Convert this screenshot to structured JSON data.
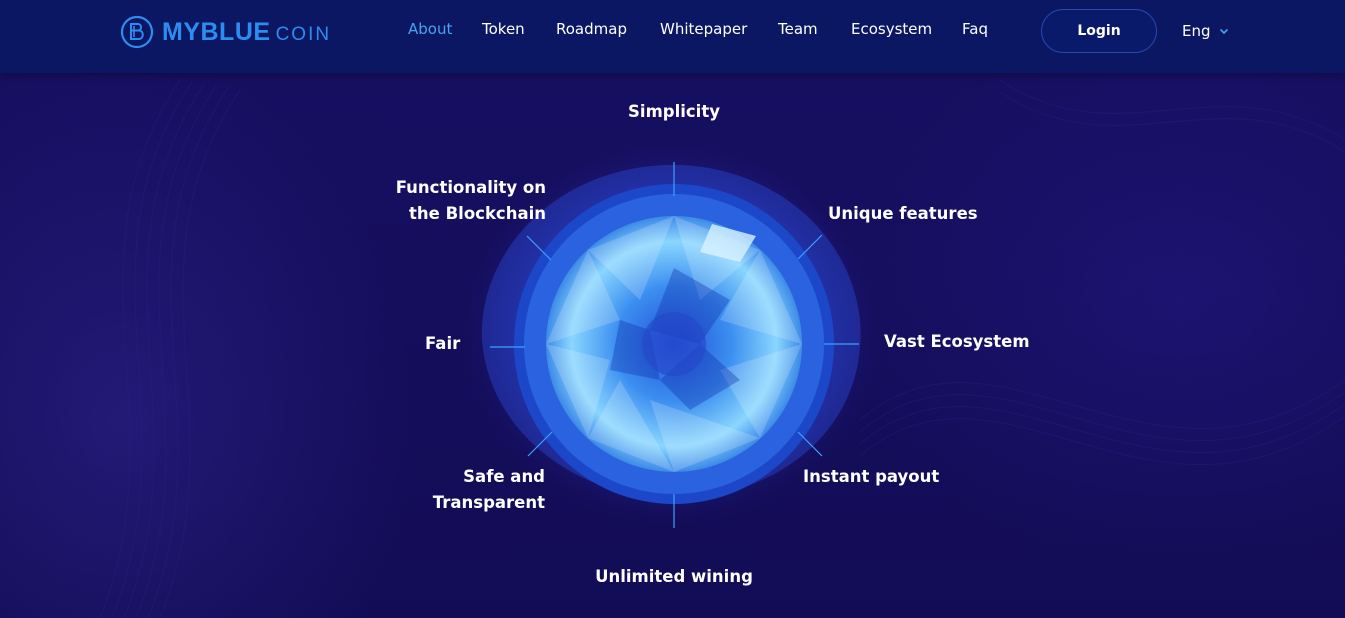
{
  "brand": {
    "name_main": "MYBLUE",
    "name_sub": "COIN",
    "accent_color": "#2c8cf0",
    "logo_icon": "coin-logo-icon"
  },
  "nav": {
    "items": [
      {
        "label": "About",
        "active": true
      },
      {
        "label": "Token",
        "active": false
      },
      {
        "label": "Roadmap",
        "active": false
      },
      {
        "label": "Whitepaper",
        "active": false
      },
      {
        "label": "Team",
        "active": false
      },
      {
        "label": "Ecosystem",
        "active": false
      },
      {
        "label": "Faq",
        "active": false
      }
    ],
    "login_label": "Login",
    "language": "Eng",
    "language_icon": "chevron-down-icon"
  },
  "features": {
    "top": "Simplicity",
    "top_left_line1": "Functionality on",
    "top_left_line2": "the Blockchain",
    "top_right": "Unique features",
    "left": "Fair",
    "right": "Vast Ecosystem",
    "bottom_left_line1": "Safe and",
    "bottom_left_line2": "Transparent",
    "bottom_right": "Instant payout",
    "bottom": "Unlimited wining"
  },
  "colors": {
    "background": "#140d5a",
    "header": "#0b1763",
    "active_nav": "#4aa3f0",
    "gem_light": "#7fd0ff",
    "gem_dark": "#1f4fd8"
  }
}
